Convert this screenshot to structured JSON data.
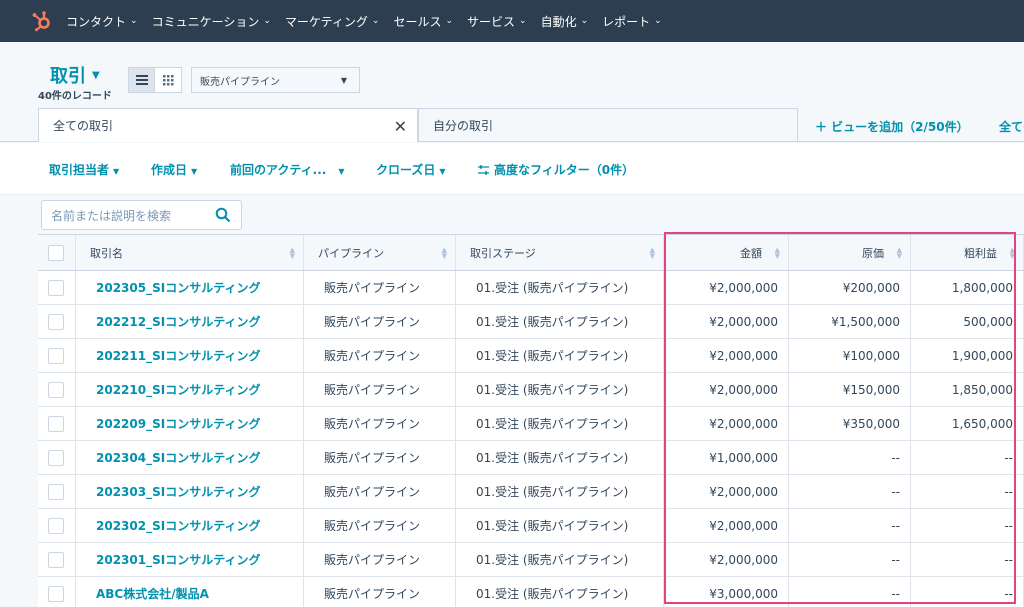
{
  "nav": {
    "items": [
      "コンタクト",
      "コミュニケーション",
      "マーケティング",
      "セールス",
      "サービス",
      "自動化",
      "レポート"
    ]
  },
  "header": {
    "title": "取引",
    "record_count": "40件のレコード",
    "pipeline": "販売パイプライン"
  },
  "tabs": {
    "all": "全ての取引",
    "mine": "自分の取引",
    "add_view": "＋ ビューを追加（2/50件）",
    "all_views": "全てのビュー"
  },
  "filters": {
    "owner": "取引担当者",
    "created": "作成日",
    "last_activity": "前回のアクティ...",
    "close_date": "クローズ日",
    "advanced": "高度なフィルター（0件）"
  },
  "search": {
    "placeholder": "名前または説明を検索"
  },
  "table": {
    "columns": [
      "取引名",
      "パイプライン",
      "取引ステージ",
      "金額",
      "原価",
      "粗利益"
    ],
    "rows": [
      {
        "name": "202305_SIコンサルティング",
        "pipeline": "販売パイプライン",
        "stage": "01.受注 (販売パイプライン)",
        "amount": "¥2,000,000",
        "cost": "¥200,000",
        "profit": "1,800,000"
      },
      {
        "name": "202212_SIコンサルティング",
        "pipeline": "販売パイプライン",
        "stage": "01.受注 (販売パイプライン)",
        "amount": "¥2,000,000",
        "cost": "¥1,500,000",
        "profit": "500,000"
      },
      {
        "name": "202211_SIコンサルティング",
        "pipeline": "販売パイプライン",
        "stage": "01.受注 (販売パイプライン)",
        "amount": "¥2,000,000",
        "cost": "¥100,000",
        "profit": "1,900,000"
      },
      {
        "name": "202210_SIコンサルティング",
        "pipeline": "販売パイプライン",
        "stage": "01.受注 (販売パイプライン)",
        "amount": "¥2,000,000",
        "cost": "¥150,000",
        "profit": "1,850,000"
      },
      {
        "name": "202209_SIコンサルティング",
        "pipeline": "販売パイプライン",
        "stage": "01.受注 (販売パイプライン)",
        "amount": "¥2,000,000",
        "cost": "¥350,000",
        "profit": "1,650,000"
      },
      {
        "name": "202304_SIコンサルティング",
        "pipeline": "販売パイプライン",
        "stage": "01.受注 (販売パイプライン)",
        "amount": "¥1,000,000",
        "cost": "--",
        "profit": "--"
      },
      {
        "name": "202303_SIコンサルティング",
        "pipeline": "販売パイプライン",
        "stage": "01.受注 (販売パイプライン)",
        "amount": "¥2,000,000",
        "cost": "--",
        "profit": "--"
      },
      {
        "name": "202302_SIコンサルティング",
        "pipeline": "販売パイプライン",
        "stage": "01.受注 (販売パイプライン)",
        "amount": "¥2,000,000",
        "cost": "--",
        "profit": "--"
      },
      {
        "name": "202301_SIコンサルティング",
        "pipeline": "販売パイプライン",
        "stage": "01.受注 (販売パイプライン)",
        "amount": "¥2,000,000",
        "cost": "--",
        "profit": "--"
      },
      {
        "name": "ABC株式会社/製品A",
        "pipeline": "販売パイプライン",
        "stage": "01.受注 (販売パイプライン)",
        "amount": "¥3,000,000",
        "cost": "--",
        "profit": "--"
      }
    ]
  },
  "colors": {
    "nav_bg": "#2d3e50",
    "accent": "#0091ae",
    "highlight": "#e5437d"
  }
}
